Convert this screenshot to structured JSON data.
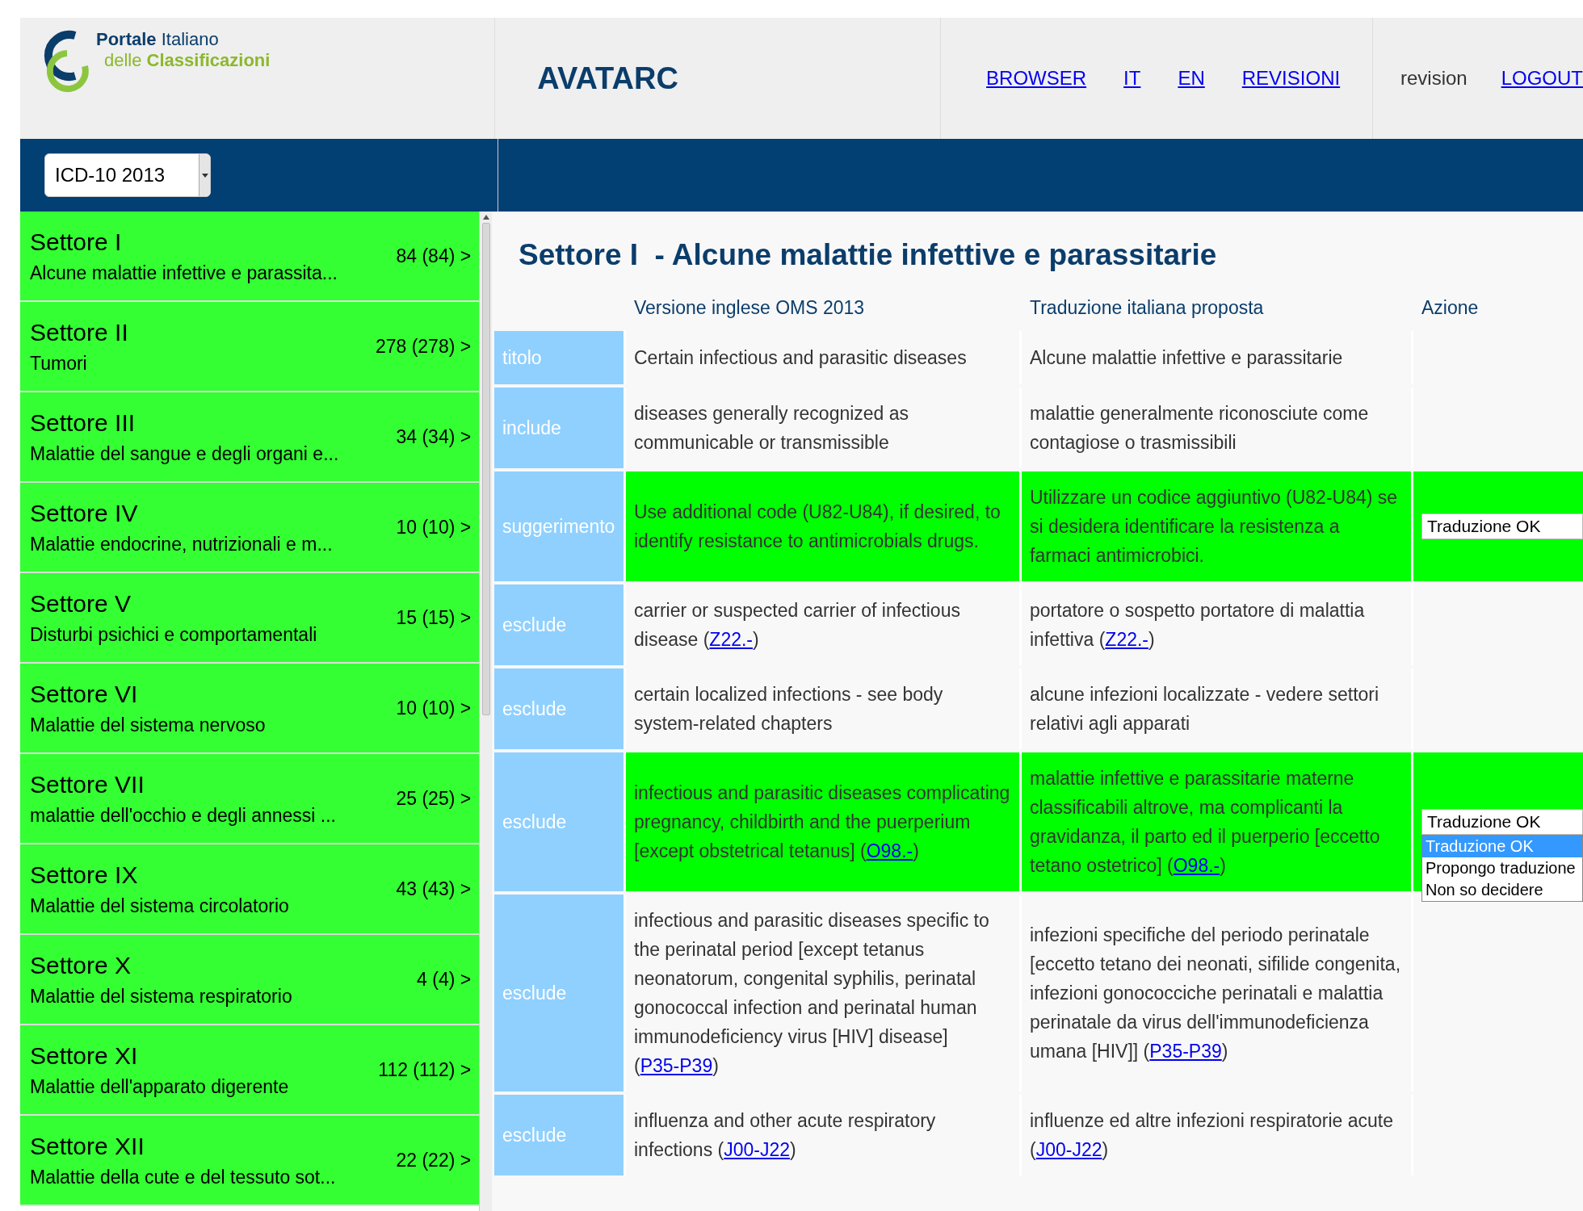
{
  "logo": {
    "line1": "**Portale** Italiano",
    "line2": "delle **Classificazioni**"
  },
  "header": {
    "title": "AVATARC",
    "nav": [
      "BROWSER",
      "IT",
      "EN",
      "REVISIONI"
    ],
    "user": "revision",
    "logout": "LOGOUT"
  },
  "version_select": {
    "value": "ICD-10 2013"
  },
  "sidebar": {
    "items": [
      {
        "title": "Settore I",
        "subtitle": "Alcune malattie infettive e parassita...",
        "count": "84 (84) >"
      },
      {
        "title": "Settore II",
        "subtitle": "Tumori",
        "count": "278 (278) >"
      },
      {
        "title": "Settore III",
        "subtitle": "Malattie del sangue e degli organi e...",
        "count": "34 (34) >"
      },
      {
        "title": "Settore IV",
        "subtitle": "Malattie endocrine, nutrizionali e m...",
        "count": "10 (10) >"
      },
      {
        "title": "Settore V",
        "subtitle": "Disturbi psichici e comportamentali",
        "count": "15 (15) >"
      },
      {
        "title": "Settore VI",
        "subtitle": "Malattie del sistema nervoso",
        "count": "10 (10) >"
      },
      {
        "title": "Settore VII",
        "subtitle": "malattie dell'occhio e degli annessi ...",
        "count": "25 (25) >"
      },
      {
        "title": "Settore IX",
        "subtitle": "Malattie del sistema circolatorio",
        "count": "43 (43) >"
      },
      {
        "title": "Settore X",
        "subtitle": "Malattie del sistema respiratorio",
        "count": "4 (4) >"
      },
      {
        "title": "Settore XI",
        "subtitle": "Malattie dell'apparato digerente",
        "count": "112 (112) >"
      },
      {
        "title": "Settore XII",
        "subtitle": "Malattie della cute e del tessuto sot...",
        "count": "22 (22) >"
      }
    ]
  },
  "main": {
    "title": "Settore I  - Alcune malattie infettive e parassitarie",
    "columns": [
      "Versione inglese OMS 2013",
      "Traduzione italiana proposta",
      "Azione"
    ],
    "rows": [
      {
        "label": "titolo",
        "highlighted": false,
        "en": {
          "text": "Certain infectious and parasitic diseases"
        },
        "it": {
          "text": "Alcune malattie infettive e parassitarie"
        }
      },
      {
        "label": "include",
        "highlighted": false,
        "en": {
          "text": "diseases generally recognized as communicable or transmissible"
        },
        "it": {
          "text": "malattie generalmente riconosciute come contagiose o trasmissibili"
        }
      },
      {
        "label": "suggerimento",
        "highlighted": true,
        "en": {
          "text": "Use additional code (U82-U84), if desired, to identify resistance to antimicrobials drugs."
        },
        "it": {
          "text": "Utilizzare un codice aggiuntivo (U82-U84) se si desidera identificare la resistenza a farmaci antimicrobici."
        },
        "action": {
          "value": "Traduzione OK"
        }
      },
      {
        "label": "esclude",
        "highlighted": false,
        "en": {
          "text": "carrier or suspected carrier of infectious disease (",
          "link": "Z22.-",
          "after": ")"
        },
        "it": {
          "text": "portatore o sospetto portatore di malattia infettiva (",
          "link": "Z22.-",
          "after": ")"
        }
      },
      {
        "label": "esclude",
        "highlighted": false,
        "en": {
          "text": "certain localized infections - see body system-related chapters"
        },
        "it": {
          "text": "alcune infezioni localizzate - vedere settori relativi agli apparati"
        }
      },
      {
        "label": "esclude",
        "highlighted": true,
        "en": {
          "text": "infectious and parasitic diseases complicating pregnancy, childbirth and the puerperium [except obstetrical tetanus] (",
          "link": "O98.-",
          "after": ")"
        },
        "it": {
          "text": "malattie infettive e parassitarie materne classificabili altrove, ma complicanti la gravidanza, il parto ed il puerperio [eccetto tetano ostetrico] (",
          "link": "O98.-",
          "after": ")"
        },
        "action": {
          "value": "Traduzione OK",
          "options": [
            {
              "label": "Traduzione OK",
              "selected": true
            },
            {
              "label": "Propongo traduzione",
              "selected": false
            },
            {
              "label": "Non so decidere",
              "selected": false
            }
          ]
        }
      },
      {
        "label": "esclude",
        "highlighted": false,
        "en": {
          "text": "infectious and parasitic diseases specific to the perinatal period [except tetanus neonatorum, congenital syphilis, perinatal gonococcal infection and perinatal human immunodeficiency virus [HIV] disease] (",
          "link": "P35-P39",
          "after": ")"
        },
        "it": {
          "text": "infezioni specifiche del periodo perinatale [eccetto tetano dei neonati, sifilide congenita, infezioni gonococciche perinatali e malattia perinatale da virus dell'immunodeficienza umana [HIV]] (",
          "link": "P35-P39",
          "after": ")"
        }
      },
      {
        "label": "esclude",
        "highlighted": false,
        "en": {
          "text": "influenza and other acute respiratory infections (",
          "link": "J00-J22",
          "after": ")"
        },
        "it": {
          "text": "influenze ed altre infezioni respiratorie acute (",
          "link": "J00-J22",
          "after": ")"
        }
      }
    ]
  }
}
